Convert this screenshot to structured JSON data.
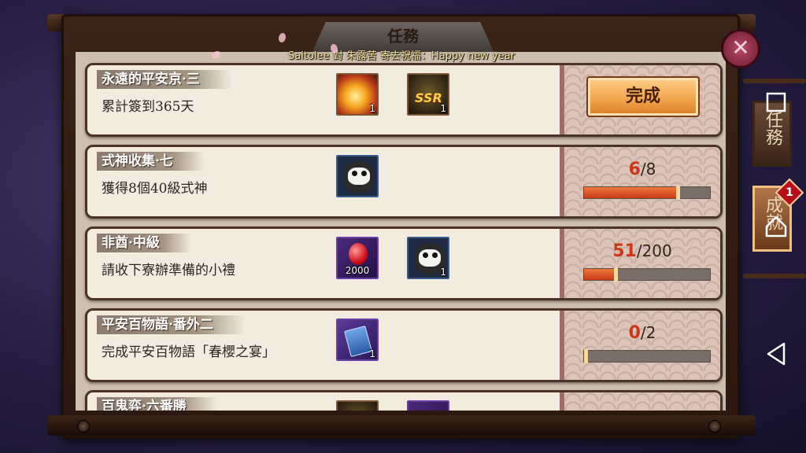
{
  "window": {
    "title": "任務"
  },
  "ticker": {
    "text": "Saitolee 對 朱露苦 寄去祝福：Happy new year"
  },
  "tasks": [
    {
      "name": "永遠的平安京·三",
      "desc": "累計簽到365天",
      "rewards": [
        {
          "icon": "fire-orb-icon",
          "count": "1"
        },
        {
          "icon": "ssr-summon-icon",
          "count": "1"
        }
      ],
      "status": "complete",
      "button_label": "完成"
    },
    {
      "name": "式神收集·七",
      "desc": "獲得8個40級式神",
      "rewards": [
        {
          "icon": "daruma-icon",
          "count": ""
        }
      ],
      "status": "progress",
      "current": "6",
      "total": "/8",
      "progress": 0.75
    },
    {
      "name": "非酋·中級",
      "desc": "請收下寮辦準備的小禮",
      "rewards": [
        {
          "icon": "jade-icon",
          "count": "2000"
        },
        {
          "icon": "daruma-icon",
          "count": "1"
        }
      ],
      "status": "progress",
      "current": "51",
      "total": "/200",
      "progress": 0.255
    },
    {
      "name": "平安百物語·番外二",
      "desc": "完成平安百物語「春櫻之宴」",
      "rewards": [
        {
          "icon": "ticket-icon",
          "count": "1"
        }
      ],
      "status": "progress",
      "current": "0",
      "total": "/2",
      "progress": 0.0
    },
    {
      "name": "百鬼弈·六番勝",
      "desc": "",
      "rewards": [],
      "status": "partial"
    }
  ],
  "sidebar": {
    "tabs": [
      {
        "label": "任務"
      },
      {
        "label": "成就"
      }
    ],
    "badge": "1"
  },
  "colors": {
    "accent": "#c8381a",
    "button": "#f1a14a",
    "panel": "#f1ebe0"
  }
}
